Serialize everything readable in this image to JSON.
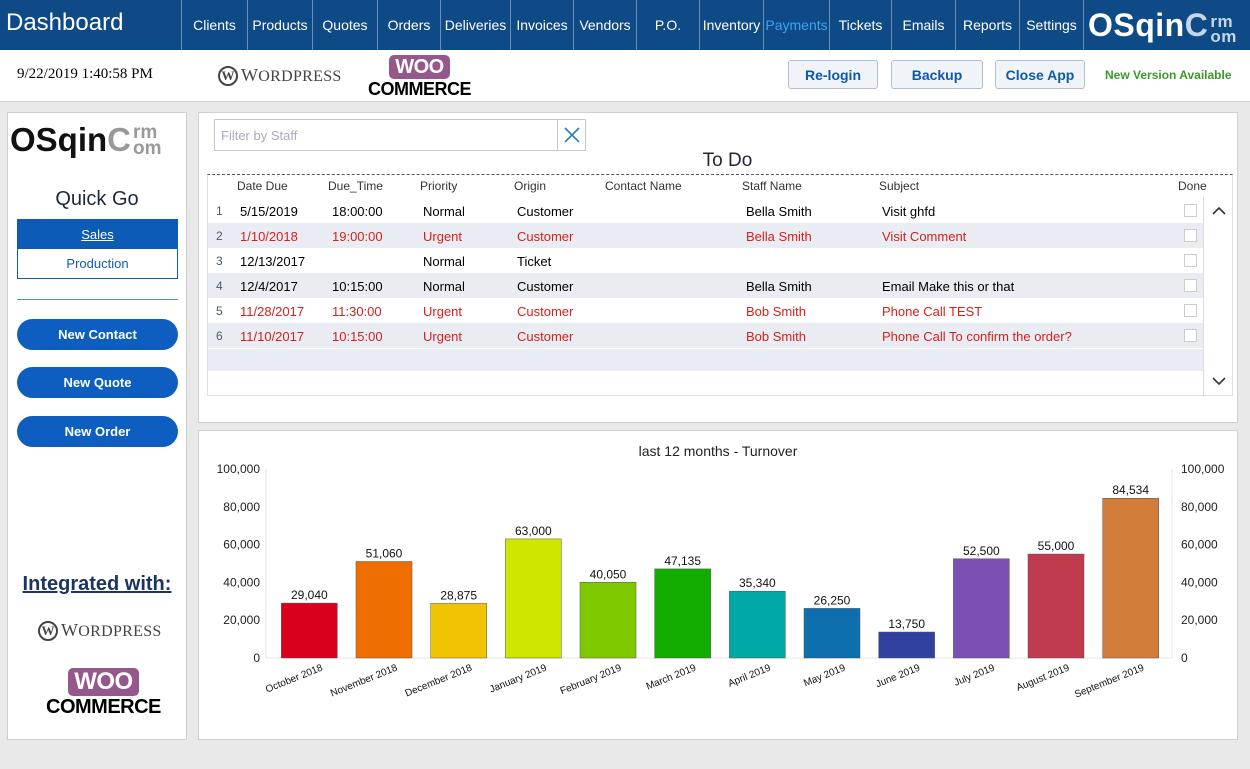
{
  "app": {
    "title": "Dashboard",
    "brand_main": "OSqin",
    "brand_top": "rm",
    "brand_bottom": "om",
    "brand_letter": "C"
  },
  "nav": [
    {
      "label": "Clients",
      "active": false
    },
    {
      "label": "Products",
      "active": false
    },
    {
      "label": "Quotes",
      "active": false
    },
    {
      "label": "Orders",
      "active": false
    },
    {
      "label": "Deliveries",
      "active": false
    },
    {
      "label": "Invoices",
      "active": false
    },
    {
      "label": "Vendors",
      "active": false
    },
    {
      "label": "P.O.",
      "active": false
    },
    {
      "label": "Inventory",
      "active": false
    },
    {
      "label": "Payments",
      "active": true
    },
    {
      "label": "Tickets",
      "active": false
    },
    {
      "label": "Emails",
      "active": false
    },
    {
      "label": "Reports",
      "active": false
    },
    {
      "label": "Settings",
      "active": false
    }
  ],
  "subbar": {
    "datetime": "9/22/2019 1:40:58 PM",
    "wordpress_logo": {
      "w": "W",
      "first": "W",
      "rest": "ORDPRESS"
    },
    "woo_logo": {
      "top": "WOO",
      "bottom": "COMMERCE"
    },
    "buttons": {
      "relogin": "Re-login",
      "backup": "Backup",
      "close": "Close App"
    },
    "new_version": "New Version Available"
  },
  "sidebar": {
    "quick_go": "Quick Go",
    "tabs": [
      {
        "label": "Sales",
        "active": true
      },
      {
        "label": "Production",
        "active": false
      }
    ],
    "actions": [
      "New Contact",
      "New Quote",
      "New Order"
    ],
    "integrated": "Integrated with:"
  },
  "todo": {
    "filter_placeholder": "Filter by Staff",
    "filter_value": "",
    "title": "To Do",
    "columns": [
      "Date Due",
      "Due_Time",
      "Priority",
      "Origin",
      "Contact Name",
      "Staff Name",
      "Subject",
      "Done"
    ],
    "rows": [
      {
        "n": "1",
        "date": "5/15/2019",
        "time": "18:00:00",
        "priority": "Normal",
        "origin": "Customer",
        "contact": "",
        "staff": "Bella Smith",
        "subject": "Visit ghfd",
        "done": false
      },
      {
        "n": "2",
        "date": "1/10/2018",
        "time": "19:00:00",
        "priority": "Urgent",
        "origin": "Customer",
        "contact": "",
        "staff": "Bella Smith",
        "subject": "Visit Comment",
        "done": false
      },
      {
        "n": "3",
        "date": "12/13/2017",
        "time": "",
        "priority": "Normal",
        "origin": "Ticket",
        "contact": "",
        "staff": "",
        "subject": "",
        "done": false
      },
      {
        "n": "4",
        "date": "12/4/2017",
        "time": "10:15:00",
        "priority": "Normal",
        "origin": "Customer",
        "contact": "",
        "staff": "Bella Smith",
        "subject": "Email Make this or that",
        "done": false
      },
      {
        "n": "5",
        "date": "11/28/2017",
        "time": "11:30:00",
        "priority": "Urgent",
        "origin": "Customer",
        "contact": "",
        "staff": "Bob Smith",
        "subject": "Phone Call TEST",
        "done": false
      },
      {
        "n": "6",
        "date": "11/10/2017",
        "time": "10:15:00",
        "priority": "Urgent",
        "origin": "Customer",
        "contact": "",
        "staff": "Bob Smith",
        "subject": "Phone Call To confirm the order?",
        "done": false
      }
    ]
  },
  "colors": {
    "nav_bg": "#0e4a85",
    "active_nav": "#3fa3f0",
    "urgent": "#d6201c",
    "accent": "#0d5ec0",
    "new_version": "#3a9a2a"
  },
  "chart_data": {
    "type": "bar",
    "title": "last 12 months - Turnover",
    "xlabel": "",
    "ylabel": "",
    "ylim": [
      0,
      100000
    ],
    "yticks": [
      "0",
      "20,000",
      "40,000",
      "60,000",
      "80,000",
      "100,000"
    ],
    "ytick_values": [
      0,
      20000,
      40000,
      60000,
      80000,
      100000
    ],
    "grid": false,
    "secondary_axis": true,
    "categories": [
      "October 2018",
      "November 2018",
      "December 2018",
      "January 2019",
      "February 2019",
      "March 2019",
      "April 2019",
      "May 2019",
      "June 2019",
      "July 2019",
      "August 2019",
      "September 2019"
    ],
    "values": [
      29040,
      51060,
      28875,
      63000,
      40050,
      47135,
      35340,
      26250,
      13750,
      52500,
      55000,
      84534
    ],
    "labels": [
      "29,040",
      "51,060",
      "28,875",
      "63,000",
      "40,050",
      "47,135",
      "35,340",
      "26,250",
      "13,750",
      "52,500",
      "55,000",
      "84,534"
    ],
    "bar_colors": [
      "#d9001b",
      "#ee6e00",
      "#f0c400",
      "#cfe600",
      "#7ec800",
      "#13ad00",
      "#00a9a6",
      "#0f6fae",
      "#3141a0",
      "#7c4fb3",
      "#c03a4e",
      "#d27d3a"
    ]
  }
}
